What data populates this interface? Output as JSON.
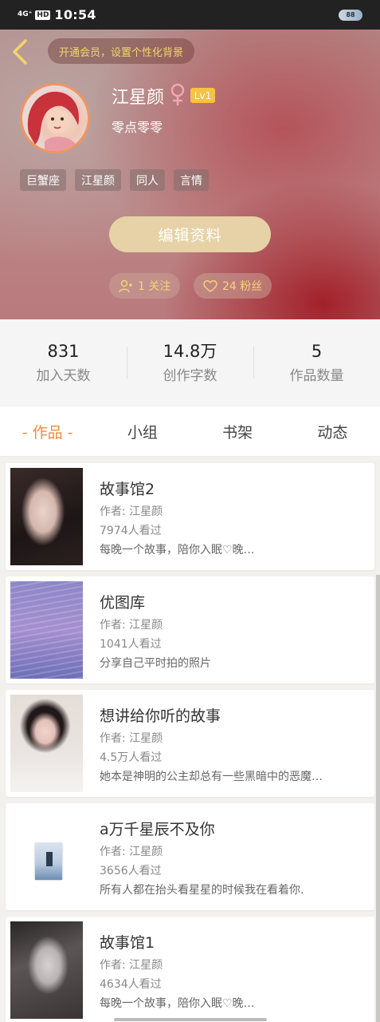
{
  "status_bar": {
    "signal": "4G⁺",
    "hd": "HD",
    "time": "10:54",
    "battery": "88"
  },
  "header": {
    "vip_banner": "开通会员，设置个性化背景"
  },
  "profile": {
    "name": "江星颜",
    "gender_symbol": "♀",
    "level": "Lv1",
    "nickname": "零点零零",
    "tags": [
      "巨蟹座",
      "江星颜",
      "同人",
      "言情"
    ],
    "edit_button": "编辑资料",
    "follow": "1 关注",
    "fans": "24 粉丝"
  },
  "stats": [
    {
      "value": "831",
      "label": "加入天数"
    },
    {
      "value": "14.8万",
      "label": "创作字数"
    },
    {
      "value": "5",
      "label": "作品数量"
    }
  ],
  "tabs": [
    "- 作品 -",
    "小组",
    "书架",
    "动态"
  ],
  "works": [
    {
      "title": "故事馆2",
      "author": "作者: 江星颜",
      "views": "7974人看过",
      "desc": "每晚一个故事，陪你入眠♡晚…"
    },
    {
      "title": "优图库",
      "author": "作者: 江星颜",
      "views": "1041人看过",
      "desc": "分享自己平时拍的照片"
    },
    {
      "title": "想讲给你听的故事",
      "author": "作者: 江星颜",
      "views": "4.5万人看过",
      "desc": "她本是神明的公主却总有一些黑暗中的恶魔…"
    },
    {
      "title": "a万千星辰不及你",
      "author": "作者: 江星颜",
      "views": "3656人看过",
      "desc": "所有人都在抬头看星星的时候我在看着你."
    },
    {
      "title": "故事馆1",
      "author": "作者: 江星颜",
      "views": "4634人看过",
      "desc": "每晚一个故事，陪你入眠♡晚…"
    }
  ],
  "colors": {
    "accent": "#f08a3c",
    "vip_text": "#f3d66a",
    "level_badge": "#f6c244",
    "edit_button": "#e6d2a6"
  }
}
